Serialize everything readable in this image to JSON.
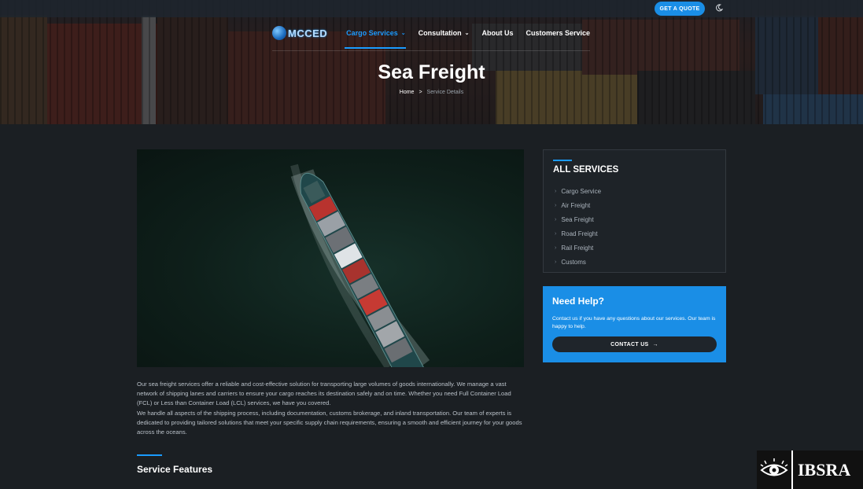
{
  "header": {
    "quote_button": "GET A QUOTE",
    "theme_icon": "moon-icon",
    "logo_text": "MCCED",
    "nav": [
      {
        "label": "Cargo Services",
        "has_dropdown": true,
        "active": true
      },
      {
        "label": "Consultation",
        "has_dropdown": true,
        "active": false
      },
      {
        "label": "About Us",
        "has_dropdown": false,
        "active": false
      },
      {
        "label": "Customers Service",
        "has_dropdown": false,
        "active": false
      }
    ]
  },
  "hero": {
    "title": "Sea Freight",
    "breadcrumb": {
      "home": "Home",
      "separator": ">",
      "current": "Service Details"
    }
  },
  "main": {
    "image_icon": "container-ship-image",
    "paragraph": "Our sea freight services offer a reliable and cost-effective solution for transporting large volumes of goods internationally. We manage a vast network of shipping lanes and carriers to ensure your cargo reaches its destination safely and on time. Whether you need Full Container Load (FCL) or Less than Container Load (LCL) services, we have you covered.",
    "paragraph2": "We handle all aspects of the shipping process, including documentation, customs brokerage, and inland transportation. Our team of experts is dedicated to providing tailored solutions that meet your specific supply chain requirements, ensuring a smooth and efficient journey for your goods across the oceans.",
    "features_title": "Service Features"
  },
  "sidebar": {
    "services_title": "ALL SERVICES",
    "services": [
      "Cargo Service",
      "Air Freight",
      "Sea Freight",
      "Road Freight",
      "Rail Freight",
      "Customs"
    ],
    "help_title": "Need Help?",
    "help_text": "Contact us if you have any questions about our services. Our team is happy to help.",
    "contact_button": "CONTACT US",
    "arrow": "→"
  },
  "watermark": {
    "text": "IBSRA"
  },
  "colors": {
    "accent": "#1a8ee6",
    "background": "#1b1f23",
    "panel": "#1e2328"
  }
}
